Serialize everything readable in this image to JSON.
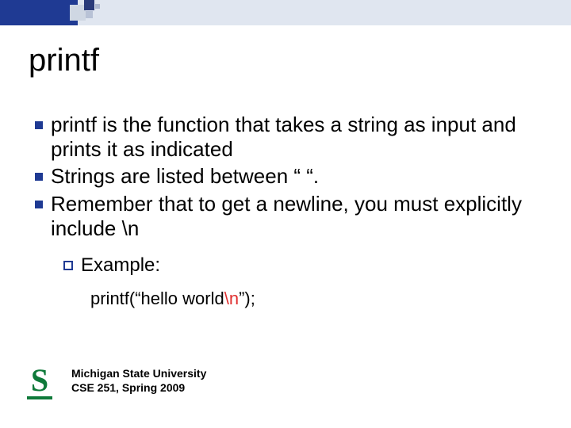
{
  "title": "printf",
  "bullets": [
    "printf is the function that takes a string as input and prints it as indicated",
    "Strings are listed between “ “.",
    "Remember that to get a newline, you must explicitly include \\n"
  ],
  "sub_label": "Example:",
  "example": {
    "prefix": "printf(“hello world",
    "newline": "\\n",
    "suffix": "”);"
  },
  "footer": {
    "line1": "Michigan State University",
    "line2": "CSE 251, Spring 2009"
  },
  "logo_letter": "S"
}
